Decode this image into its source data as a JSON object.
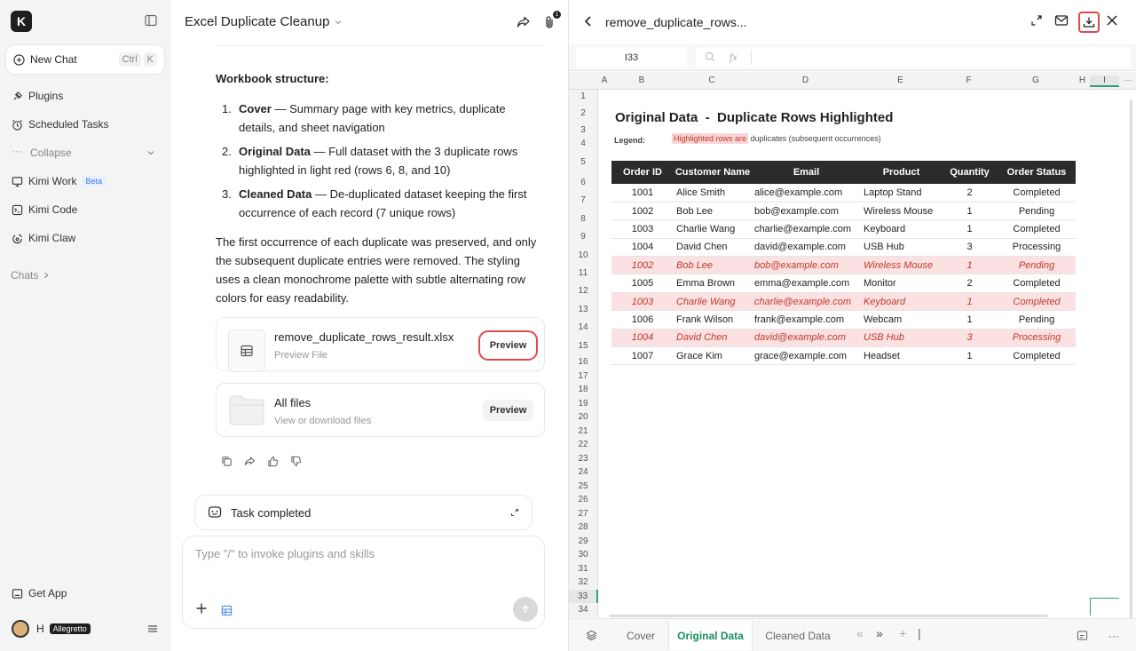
{
  "sidebar": {
    "logo_text": "K",
    "new_chat_label": "New Chat",
    "shortcut_ctrl": "Ctrl",
    "shortcut_key": "K",
    "items": [
      {
        "label": "Plugins"
      },
      {
        "label": "Scheduled Tasks"
      },
      {
        "label": "Collapse"
      },
      {
        "label": "Kimi Work",
        "badge": "Beta"
      },
      {
        "label": "Kimi Code"
      },
      {
        "label": "Kimi Claw"
      }
    ],
    "chats_label": "Chats",
    "get_app_label": "Get App",
    "user_name": "H",
    "user_tag": "Allegretto"
  },
  "chat": {
    "title": "Excel Duplicate Cleanup",
    "attachment_count": "1",
    "heading": "Workbook structure:",
    "list": [
      {
        "num": "1.",
        "bold": "Cover",
        "text": " — Summary page with key metrics, duplicate details, and sheet navigation"
      },
      {
        "num": "2.",
        "bold": "Original Data",
        "text": " — Full dataset with the 3 duplicate rows highlighted in light red (rows 6, 8, and 10)"
      },
      {
        "num": "3.",
        "bold": "Cleaned Data",
        "text": " — De-duplicated dataset keeping the first occurrence of each record (7 unique rows)"
      }
    ],
    "paragraph": "The first occurrence of each duplicate was preserved, and only the subsequent duplicate entries were removed. The styling uses a clean monochrome palette with subtle alternating row colors for easy readability.",
    "file_card": {
      "name": "remove_duplicate_rows_result.xlsx",
      "sub": "Preview File",
      "button": "Preview"
    },
    "all_files_card": {
      "name": "All files",
      "sub": "View or download files",
      "button": "Preview"
    },
    "task_status": "Task completed",
    "input_placeholder": "Type \"/\" to invoke plugins and skills"
  },
  "preview": {
    "title": "remove_duplicate_rows...",
    "cell_ref": "I33",
    "fx_label": "fx",
    "columns": [
      "A",
      "B",
      "C",
      "D",
      "E",
      "F",
      "G",
      "H",
      "I"
    ],
    "row_numbers": [
      "1",
      "2",
      "3",
      "4",
      "5",
      "6",
      "7",
      "8",
      "9",
      "10",
      "11",
      "12",
      "13",
      "14",
      "15",
      "16",
      "17",
      "18",
      "19",
      "20",
      "21",
      "22",
      "23",
      "24",
      "25",
      "26",
      "27",
      "28",
      "29",
      "30",
      "31",
      "32",
      "33",
      "34"
    ],
    "sheet_title": "Original Data  -  Duplicate Rows Highlighted",
    "legend_label": "Legend:",
    "legend_highlight": "Highlighted rows are",
    "legend_rest": " duplicates (subsequent occurrences)",
    "table_headers": [
      "Order ID",
      "Customer Name",
      "Email",
      "Product",
      "Quantity",
      "Order Status"
    ],
    "rows": [
      {
        "dup": false,
        "cells": [
          "1001",
          "Alice Smith",
          "alice@example.com",
          "Laptop Stand",
          "2",
          "Completed"
        ]
      },
      {
        "dup": false,
        "cells": [
          "1002",
          "Bob Lee",
          "bob@example.com",
          "Wireless Mouse",
          "1",
          "Pending"
        ]
      },
      {
        "dup": false,
        "cells": [
          "1003",
          "Charlie Wang",
          "charlie@example.com",
          "Keyboard",
          "1",
          "Completed"
        ]
      },
      {
        "dup": false,
        "cells": [
          "1004",
          "David Chen",
          "david@example.com",
          "USB Hub",
          "3",
          "Processing"
        ]
      },
      {
        "dup": true,
        "cells": [
          "1002",
          "Bob Lee",
          "bob@example.com",
          "Wireless Mouse",
          "1",
          "Pending"
        ]
      },
      {
        "dup": false,
        "cells": [
          "1005",
          "Emma Brown",
          "emma@example.com",
          "Monitor",
          "2",
          "Completed"
        ]
      },
      {
        "dup": true,
        "cells": [
          "1003",
          "Charlie Wang",
          "charlie@example.com",
          "Keyboard",
          "1",
          "Completed"
        ]
      },
      {
        "dup": false,
        "cells": [
          "1006",
          "Frank Wilson",
          "frank@example.com",
          "Webcam",
          "1",
          "Pending"
        ]
      },
      {
        "dup": true,
        "cells": [
          "1004",
          "David Chen",
          "david@example.com",
          "USB Hub",
          "3",
          "Processing"
        ]
      },
      {
        "dup": false,
        "cells": [
          "1007",
          "Grace Kim",
          "grace@example.com",
          "Headset",
          "1",
          "Completed"
        ]
      }
    ],
    "sheet_tabs": [
      "Cover",
      "Original Data",
      "Cleaned Data"
    ],
    "active_tab": "Original Data"
  },
  "colors": {
    "accent_green": "#1a8f5e",
    "highlight_red": "#e04a4a",
    "dup_row_bg": "#fbe1e1",
    "dup_row_text": "#c0392b"
  }
}
